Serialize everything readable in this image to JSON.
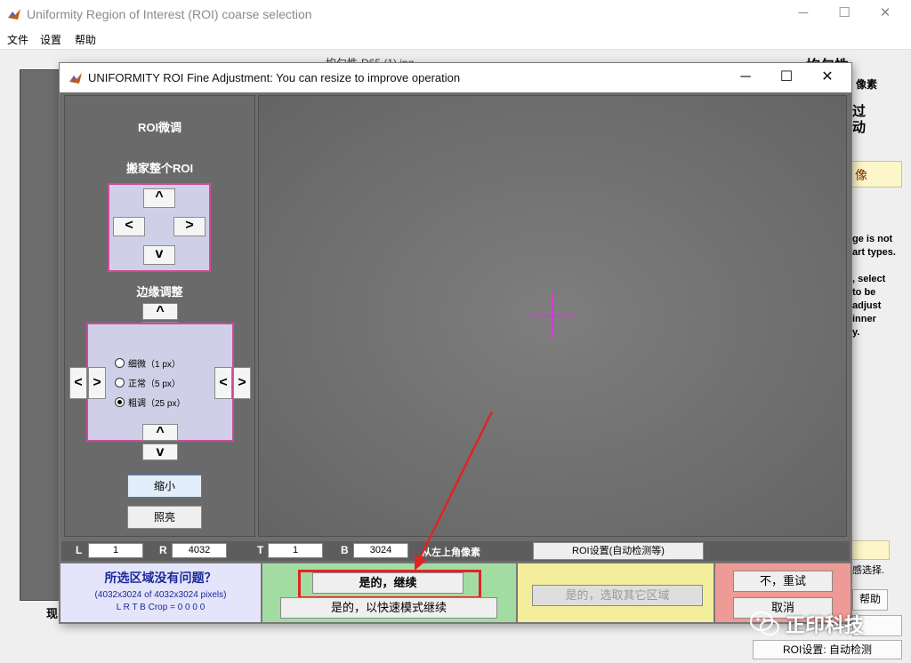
{
  "back_window": {
    "title": "Uniformity Region of Interest (ROI) coarse selection",
    "menu": [
      "文件",
      "设置",
      "帮助"
    ],
    "filename": "均匀性-D65 (1).jpg",
    "right_title": "均匀性",
    "right_texts": [
      "像素",
      "过",
      "动"
    ],
    "image_btn": "像",
    "right_text_block": "ge is not\nart types.\n\n, select\nto be\nadjust\ninner\ny.",
    "select_hint": "感选择.",
    "help_btn": "帮助",
    "roi_btn": "ROI设置: 自动检测",
    "now_label": "现"
  },
  "dialog": {
    "title": "UNIFORMITY ROI Fine Adjustment: You can resize to improve operation",
    "roi_title": "ROI微调",
    "move_title": "搬家整个ROI",
    "edge_title": "边缘调整",
    "arrows": {
      "up": "^",
      "down": "v",
      "left": "<",
      "right": ">"
    },
    "radio_options": [
      "细微（1 px）",
      "正常（5 px）",
      "粗调（25 px）"
    ],
    "selected_option": 2,
    "shrink_btn": "缩小",
    "brighten_btn": "照亮",
    "coords": {
      "L_label": "L",
      "L": "1",
      "R_label": "R",
      "R": "4032",
      "T_label": "T",
      "T": "1",
      "B_label": "B",
      "B": "3024",
      "note": "从左上角像素"
    },
    "roi_settings_btn": "ROI设置(自动检测等)",
    "question": {
      "title": "所选区域没有问题？",
      "line1": "(4032x3024 of 4032x3024 pixels)",
      "line2": "L R T B Crop = 0  0  0  0"
    },
    "yes_continue": "是的，继续",
    "yes_fast": "是的，以快速模式继续",
    "yes_other": "是的，选取其它区域",
    "no_retry": "不，重试",
    "cancel": "取消"
  },
  "watermark": "正印科技",
  "colors": {
    "pink_border": "#d04a9a",
    "crosshair": "#d03ed0",
    "annotation_red": "#e02424",
    "green_panel": "#a3dca3",
    "yellow_panel": "#f3ee9c",
    "red_panel": "#ee9a96",
    "question_panel": "#e4e4fb"
  },
  "icons": {
    "app_icon": "matlab-icon",
    "minimize": "minimize-icon",
    "maximize": "maximize-icon",
    "close": "close-icon"
  }
}
